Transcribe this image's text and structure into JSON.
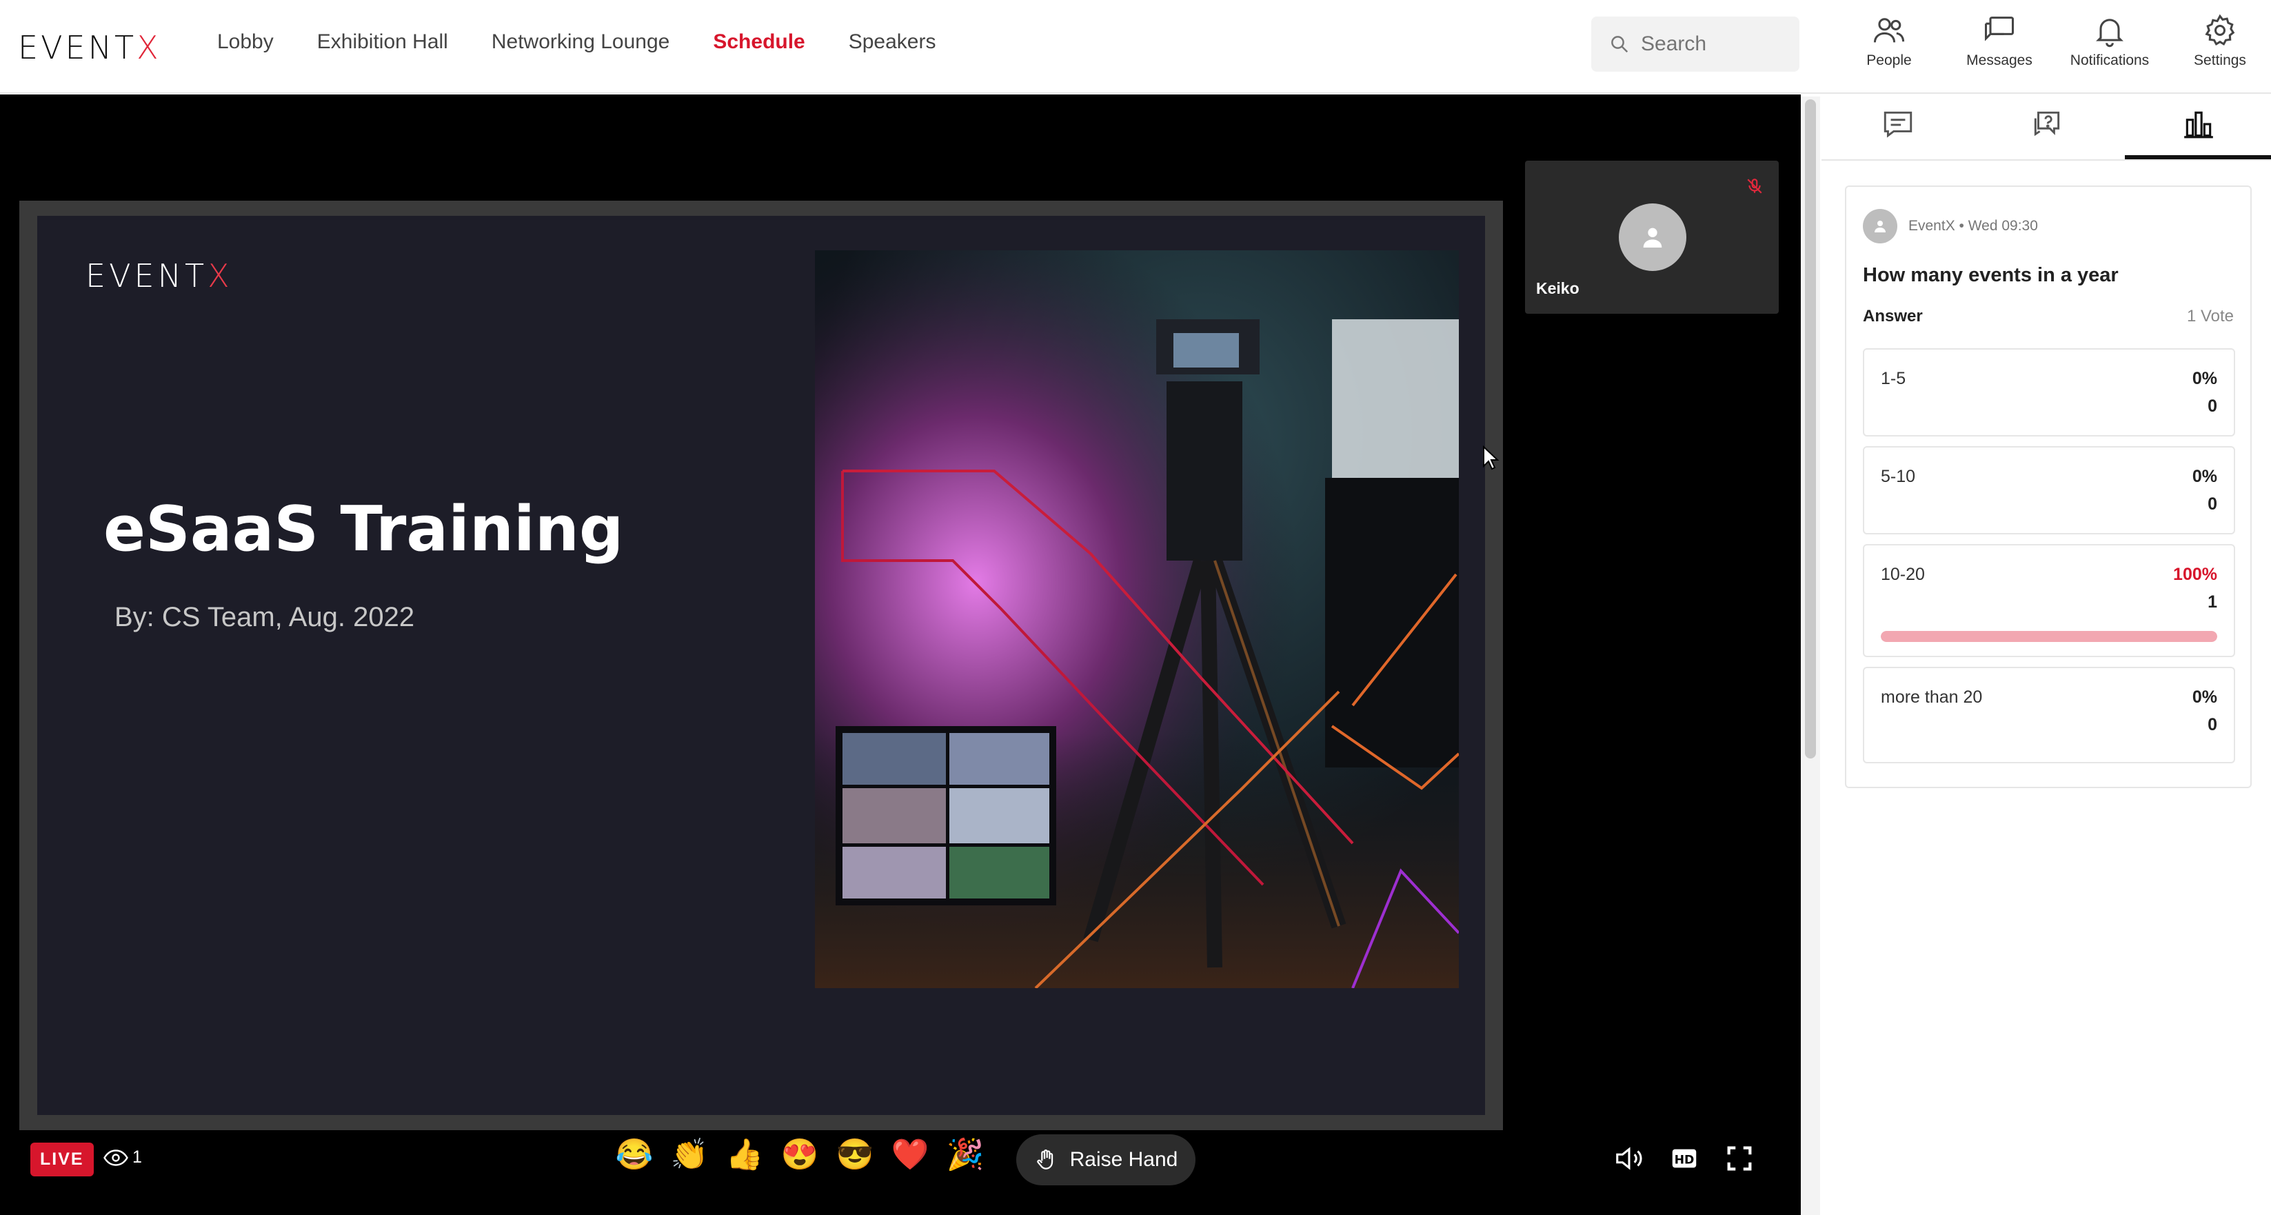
{
  "header": {
    "logo": {
      "text": "EVENT",
      "accent": "X"
    },
    "nav": [
      {
        "label": "Lobby",
        "active": false
      },
      {
        "label": "Exhibition Hall",
        "active": false
      },
      {
        "label": "Networking Lounge",
        "active": false
      },
      {
        "label": "Schedule",
        "active": true
      },
      {
        "label": "Speakers",
        "active": false
      }
    ],
    "search": {
      "placeholder": "Search"
    },
    "actions": [
      {
        "label": "People",
        "icon": "people-icon"
      },
      {
        "label": "Messages",
        "icon": "messages-icon"
      },
      {
        "label": "Notifications",
        "icon": "bell-icon"
      },
      {
        "label": "Settings",
        "icon": "gear-icon"
      }
    ]
  },
  "stage": {
    "slide": {
      "logo": {
        "text": "EVENT",
        "accent": "X"
      },
      "title": "eSaaS Training",
      "subtitle": "By: CS Team, Aug. 2022"
    },
    "participant": {
      "name": "Keiko",
      "muted": true
    },
    "live_label": "LIVE",
    "viewer_count": "1",
    "reactions": [
      "😂",
      "👏",
      "👍",
      "😍",
      "😎",
      "❤️",
      "🎉"
    ],
    "raise_hand_label": "Raise Hand",
    "controls": [
      "volume-icon",
      "hd-icon",
      "fullscreen-icon"
    ]
  },
  "panel": {
    "tabs": [
      {
        "icon": "chat-icon",
        "active": false
      },
      {
        "icon": "qa-icon",
        "active": false
      },
      {
        "icon": "poll-icon",
        "active": true
      }
    ],
    "poll": {
      "author": "EventX • Wed 09:30",
      "question": "How many events in a year",
      "answer_label": "Answer",
      "votes_label": "1 Vote",
      "options": [
        {
          "label": "1-5",
          "percent": "0%",
          "count": "0",
          "fraction": 0
        },
        {
          "label": "5-10",
          "percent": "0%",
          "count": "0",
          "fraction": 0
        },
        {
          "label": "10-20",
          "percent": "100%",
          "count": "1",
          "fraction": 1
        },
        {
          "label": "more than 20",
          "percent": "0%",
          "count": "0",
          "fraction": 0
        }
      ]
    }
  },
  "colors": {
    "accent": "#d7162c",
    "stage_bg": "#000000",
    "poll_fill": "#f2a7b1"
  }
}
